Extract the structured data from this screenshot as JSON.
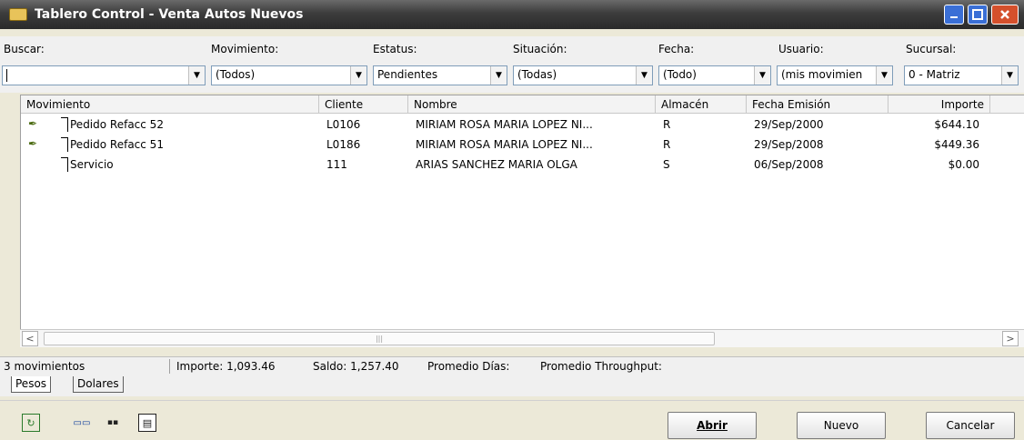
{
  "window": {
    "title": "Tablero Control - Venta Autos Nuevos"
  },
  "filters": {
    "buscar": {
      "label": "Buscar:",
      "value": ""
    },
    "movimiento": {
      "label": "Movimiento:",
      "value": "(Todos)"
    },
    "estatus": {
      "label": "Estatus:",
      "value": "Pendientes"
    },
    "situacion": {
      "label": "Situación:",
      "value": "(Todas)"
    },
    "fecha": {
      "label": "Fecha:",
      "value": "(Todo)"
    },
    "usuario": {
      "label": "Usuario:",
      "value": "(mis movimien"
    },
    "sucursal": {
      "label": "Sucursal:",
      "value": "0 - Matriz"
    }
  },
  "grid": {
    "columns": [
      "Movimiento",
      "Cliente",
      "Nombre",
      "Almacén",
      "Fecha Emisión",
      "Importe"
    ],
    "rows": [
      {
        "movimiento": "Pedido Refacc 52",
        "cliente": "L0106",
        "nombre": "MIRIAM ROSA MARIA LOPEZ  NI...",
        "almacen": "R",
        "fecha": "29/Sep/2000",
        "importe": "$644.10",
        "flag": true
      },
      {
        "movimiento": "Pedido Refacc 51",
        "cliente": "L0186",
        "nombre": "MIRIAM ROSA MARIA LOPEZ  NI...",
        "almacen": "R",
        "fecha": "29/Sep/2008",
        "importe": "$449.36",
        "flag": true
      },
      {
        "movimiento": "Servicio",
        "cliente": "111",
        "nombre": "ARIAS SANCHEZ MARIA OLGA",
        "almacen": "S",
        "fecha": "06/Sep/2008",
        "importe": "$0.00",
        "flag": false
      }
    ]
  },
  "status": {
    "count": "3 movimientos",
    "importe": "Importe: 1,093.46",
    "saldo": "Saldo: 1,257.40",
    "promedio_dias": "Promedio Días:",
    "promedio_throughput": "Promedio Throughput:"
  },
  "tabs": [
    "Pesos",
    "Dolares"
  ],
  "buttons": {
    "abrir": "Abrir",
    "nuevo": "Nuevo",
    "cancelar": "Cancelar"
  },
  "icons": [
    "refresh-icon",
    "print-preview-icon",
    "columns-icon",
    "grid-view-icon"
  ],
  "colors": {
    "titlebar": "#3c3c3c",
    "close": "#d4502c"
  }
}
